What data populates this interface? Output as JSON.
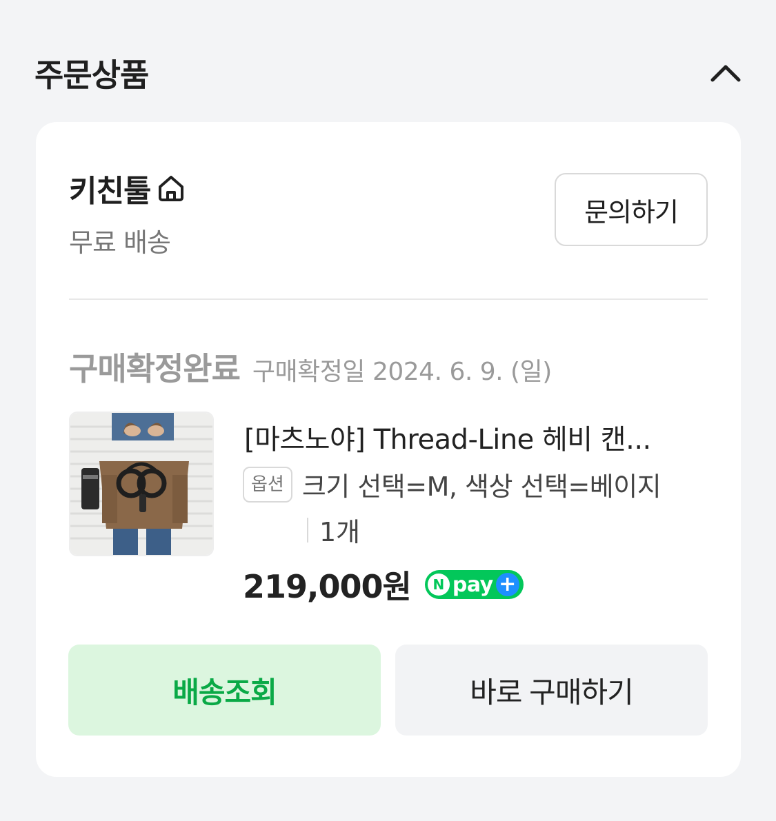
{
  "section": {
    "title": "주문상품"
  },
  "seller": {
    "name": "키친툴",
    "shipping": "무료 배송",
    "inquiry_label": "문의하기"
  },
  "order": {
    "status": "구매확정완료",
    "confirm_date": "구매확정일 2024. 6. 9. (일)"
  },
  "product": {
    "title": "[마츠노야] Thread-Line 헤비 캔...",
    "option_badge": "옵션",
    "option_text": "크기 선택=M, 색상 선택=베이지",
    "quantity": "1개",
    "price": "219,000원",
    "npay_text": "pay"
  },
  "actions": {
    "track_label": "배송조회",
    "buy_again_label": "바로 구매하기"
  },
  "colors": {
    "accent_green": "#03c75a",
    "track_text": "#0aa946",
    "track_bg": "#dcf6df",
    "npay_plus": "#1e8fff"
  },
  "icons": {
    "collapse": "chevron-up-icon",
    "store": "home-icon",
    "npay": "npay-plus-logo"
  }
}
